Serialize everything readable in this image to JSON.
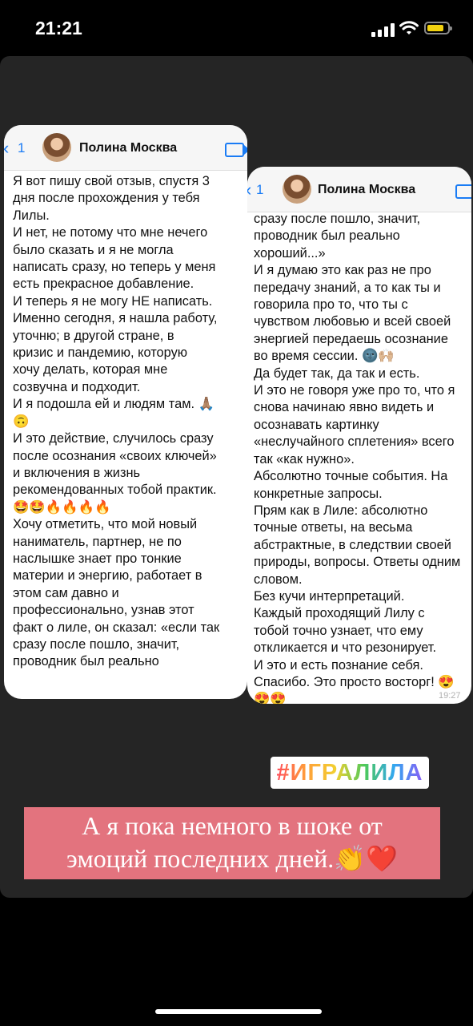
{
  "status": {
    "time": "21:21",
    "battery_color": "#f2d20f"
  },
  "chat_left": {
    "back_count": "1",
    "contact_name": "Полина Москва",
    "message": "Я вот пишу свой отзыв, спустя 3\nдня после прохождения у тебя\nЛилы.\nИ нет, не потому что мне нечего\nбыло сказать и я не могла\nнаписать сразу, но теперь у меня\nесть прекрасное добавление.\nИ теперь я не могу НЕ написать.\nИменно сегодня, я нашла работу,\nуточню; в другой стране, в\nкризис и пандемию, которую\nхочу делать, которая мне\nсозвучна и подходит.\nИ я подошла ей и людям там. 🙏🏽\n🙃\nИ это действие, случилось сразу\nпосле осознания «своих ключей»\nи включения в жизнь\nрекомендованных тобой практик.\n🤩🤩🔥🔥🔥🔥\nХочу отметить, что мой новый\nнаниматель, партнер, не по\nнаслышке знает про тонкие\nматерии и энергию, работает в\nэтом сам давно и\nпрофессионально, узнав этот\nфакт о лиле, он сказал: «если так\nсразу после пошло, значит,\nпроводник был реально"
  },
  "chat_right": {
    "back_count": "1",
    "contact_name": "Полина Москва",
    "message": "сразу после пошло, значит,\nпроводник был реально\nхороший...»\nИ я думаю это как раз не про\nпередачу знаний, а то как ты и\nговорила про то, что ты с\nчувством любовью и всей своей\nэнергией передаешь осознание\nво время сессии. 🌚🙌🏼\nДа будет так, да так и есть.\nИ это не говоря уже про то, что я\nснова начинаю явно видеть и\nосознавать картинку\n«неслучайного сплетения» всего\nтак «как нужно».\nАбсолютно точные события. На\nконкретные запросы.\nПрям как в Лиле: абсолютно\nточные ответы, на весьма\nабстрактные, в следствии своей\nприроды, вопросы. Ответы одним\nсловом.\nБез кучи интерпретаций.\nКаждый проходящий Лилу с\nтобой точно узнает, что ему\nоткликается и что резонирует.\nИ это и есть познание себя.\nСпасибо. Это просто восторг!  😍\n😍😍",
    "timestamp": "19:27"
  },
  "hashtag": "#ИГРАЛИЛА",
  "caption": {
    "line1": "А я пока немного в шоке от",
    "line2": "эмоций последних дней.👏❤️"
  }
}
